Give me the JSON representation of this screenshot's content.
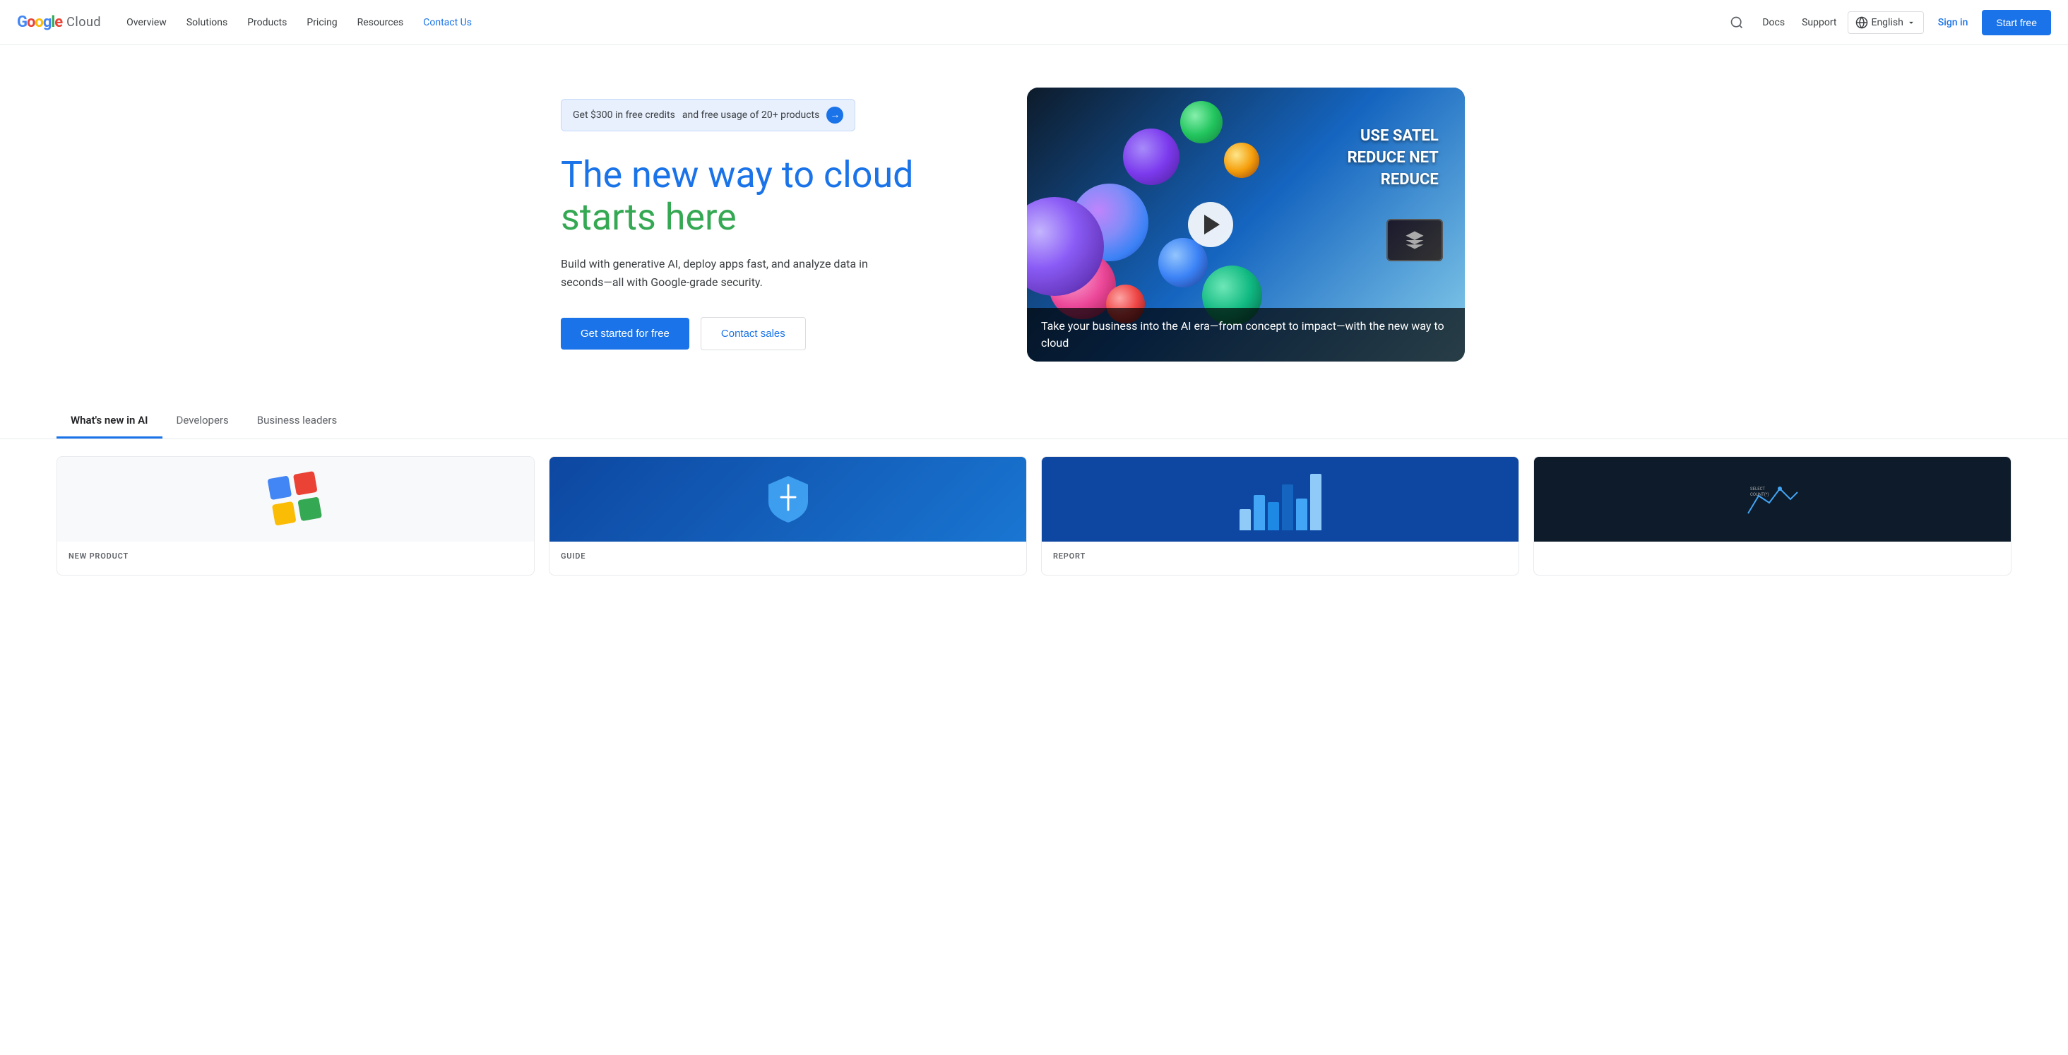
{
  "nav": {
    "logo_google": "Google",
    "logo_cloud": "Cloud",
    "links": [
      {
        "id": "overview",
        "label": "Overview"
      },
      {
        "id": "solutions",
        "label": "Solutions"
      },
      {
        "id": "products",
        "label": "Products"
      },
      {
        "id": "pricing",
        "label": "Pricing"
      },
      {
        "id": "resources",
        "label": "Resources"
      },
      {
        "id": "contact",
        "label": "Contact Us",
        "active": true
      }
    ],
    "docs": "Docs",
    "support": "Support",
    "language": "English",
    "signin": "Sign in",
    "start_free": "Start free"
  },
  "hero": {
    "banner_bold": "Get $300 in free credits",
    "banner_text": " and free usage of 20+ products",
    "title_line1": "The new way to cloud",
    "title_line2": "starts here",
    "description": "Build with generative AI, deploy apps fast, and analyze data in seconds—all with Google-grade security.",
    "btn_primary": "Get started for free",
    "btn_secondary": "Contact sales",
    "video_overlay_line1": "USE  SATEL",
    "video_overlay_line2": "REDUCE NET",
    "video_overlay_line3": "REDUCE",
    "video_caption": "Take your business into the AI era—from concept to impact—with the new way to cloud"
  },
  "tabs": [
    {
      "id": "ai",
      "label": "What's new in AI",
      "active": true
    },
    {
      "id": "developers",
      "label": "Developers",
      "active": false
    },
    {
      "id": "business",
      "label": "Business leaders",
      "active": false
    }
  ],
  "cards": [
    {
      "id": "card1",
      "label": "NEW PRODUCT",
      "title": "",
      "image_type": "colorful"
    },
    {
      "id": "card2",
      "label": "GUIDE",
      "title": "",
      "image_type": "shield"
    },
    {
      "id": "card3",
      "label": "REPORT",
      "title": "",
      "image_type": "chart"
    },
    {
      "id": "card4",
      "label": "",
      "title": "",
      "image_type": "chart2"
    }
  ]
}
